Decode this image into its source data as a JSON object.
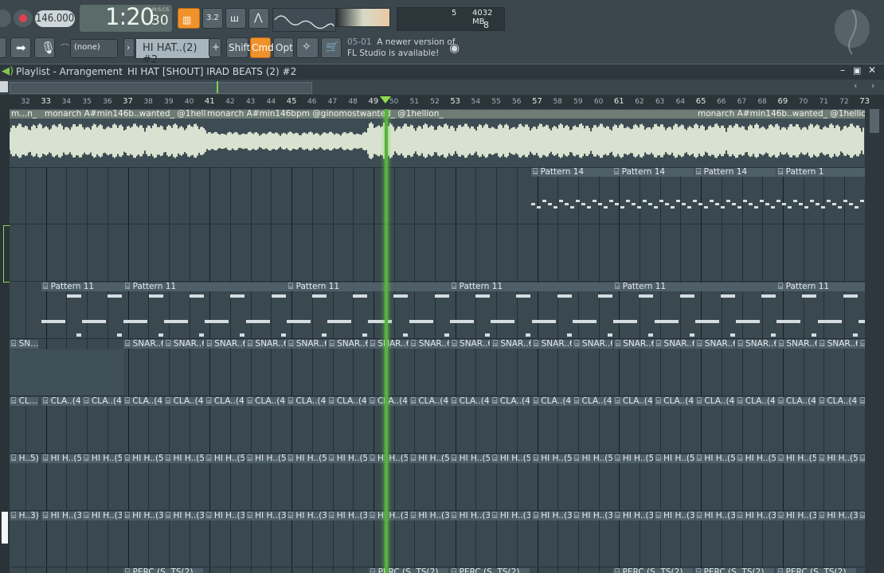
{
  "toolbar": {
    "tempo": "146.000",
    "time_main": "1:20",
    "time_sub": "30",
    "time_unit": "M:S:CS",
    "memory": "4032 MB",
    "cpu": "5",
    "voices": "8",
    "pattern_select": "(none)",
    "pattern_name": "HI HAT..(2) #2",
    "shift_label": "Shift",
    "cmd_label": "Cmd",
    "opt_label": "Opt",
    "news_date": "05-01",
    "news_line1": "A newer version of",
    "news_line2": "FL Studio is available!",
    "plus": "+"
  },
  "playlist": {
    "title": "Playlist - Arrangement",
    "breadcrumb": "HI HAT [SHOUT] IRAD BEATS (2) #2"
  },
  "ruler": {
    "ticks": [
      "32",
      "33",
      "34",
      "35",
      "36",
      "37",
      "38",
      "39",
      "40",
      "41",
      "42",
      "43",
      "44",
      "45",
      "46",
      "47",
      "48",
      "49",
      "50",
      "51",
      "52",
      "53",
      "54",
      "55",
      "56",
      "57",
      "58",
      "59",
      "60",
      "61",
      "62",
      "63",
      "64",
      "65",
      "66",
      "67",
      "68",
      "69",
      "70",
      "71",
      "72",
      "73"
    ]
  },
  "tracks": {
    "audio_clips": [
      "m...n_",
      "monarch A#min146b..wanted_ @1hellion_",
      "monarch A#min146bpm @ginomostwanted_ @1hellion_",
      "monarch A#min146b..wanted_ @1hellion_"
    ],
    "pattern14": [
      "Pattern 14",
      "Pattern 14",
      "Pattern 14",
      "Pattern 1"
    ],
    "pattern11": [
      "Pattern 11",
      "Pattern 11",
      "Pattern 11",
      "Pattern 11",
      "Pattern 11",
      "Pattern 11"
    ],
    "snare_first": "SN...",
    "snare": "SNAR..6)",
    "clap_first": "CL...",
    "clap": "CLA..(4)",
    "hihat5_first": "H..5)",
    "hihat5": "HI H..(5)",
    "hihat3_first": "H..3)",
    "hihat3": "HI H..(3)",
    "perc": "PERC (S..TS(2)"
  },
  "colors": {
    "accent": "#f0922c",
    "playhead": "#59b13c",
    "background": "#34414a"
  }
}
